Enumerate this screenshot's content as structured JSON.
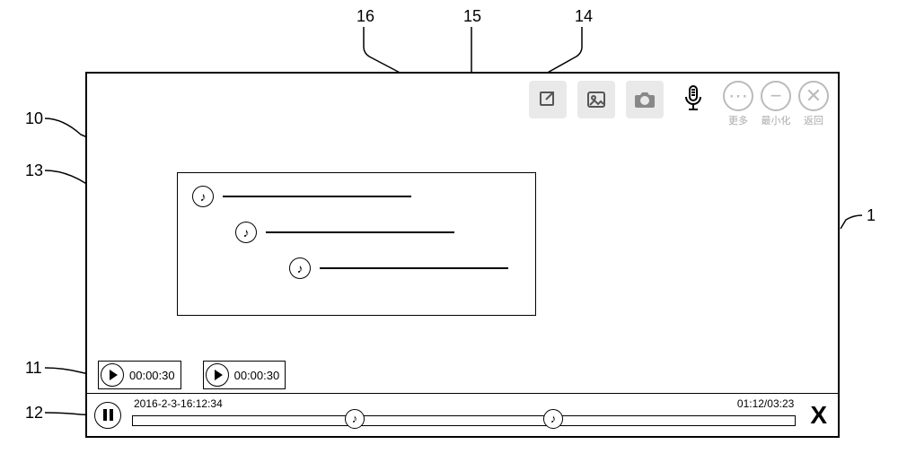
{
  "callouts": {
    "c1": "1",
    "c10": "10",
    "c11": "11",
    "c12": "12",
    "c13": "13",
    "c14": "14",
    "c15": "15",
    "c16": "16"
  },
  "toolbar": {
    "round_more": "更多",
    "round_min": "最小化",
    "round_back": "返回"
  },
  "note_glyph": "♪",
  "clips": [
    {
      "time": "00:00:30"
    },
    {
      "time": "00:00:30"
    }
  ],
  "player": {
    "timestamp": "2016-2-3-16:12:34",
    "timecount": "01:12/03:23",
    "markers": [
      {
        "pos_pct": 32
      },
      {
        "pos_pct": 62
      }
    ]
  },
  "close": "X"
}
